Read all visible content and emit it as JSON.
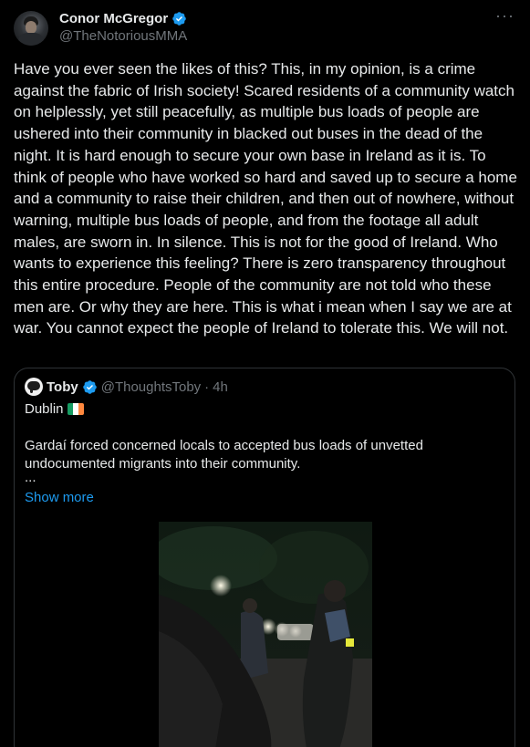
{
  "tweet": {
    "display_name": "Conor McGregor",
    "handle": "@TheNotoriousMMA",
    "verified_icon": "verified-badge-icon",
    "more_icon": "more-options-icon",
    "text": "Have you ever seen the likes of this? This, in my opinion, is a crime against the fabric of Irish society! Scared residents of a community watch on helplessly, yet still peacefully, as multiple bus loads of people are ushered into their community in blacked out buses in the dead of the night. It is hard enough to secure your own base in Ireland as it is. To think of people who have worked so hard and saved up to secure a home and a community to raise their children, and then out of nowhere, without warning, multiple bus loads of people, and from the footage all adult males, are sworn in. In silence. This is not for the good of Ireland. Who wants to experience this feeling? There is zero transparency throughout this entire procedure. People of the community are not told who these men are. Or why they are here. This is what i mean when I say we are at war. You cannot expect the people of Ireland to tolerate this. We will not."
  },
  "quoted": {
    "display_name": "Toby",
    "handle": "@ThoughtsToby",
    "separator": "·",
    "time": "4h",
    "place": "Dublin",
    "flag": "ireland-flag-icon",
    "text": "Gardaí forced concerned locals to accepted bus loads of unvetted undocumented migrants into their community.",
    "ellipsis": "...",
    "show_more": "Show more"
  },
  "colors": {
    "background": "#000000",
    "text": "#e7e9ea",
    "secondary": "#71767b",
    "link": "#1d9bf0",
    "verified": "#1d9bf0",
    "border": "#2f3336"
  }
}
